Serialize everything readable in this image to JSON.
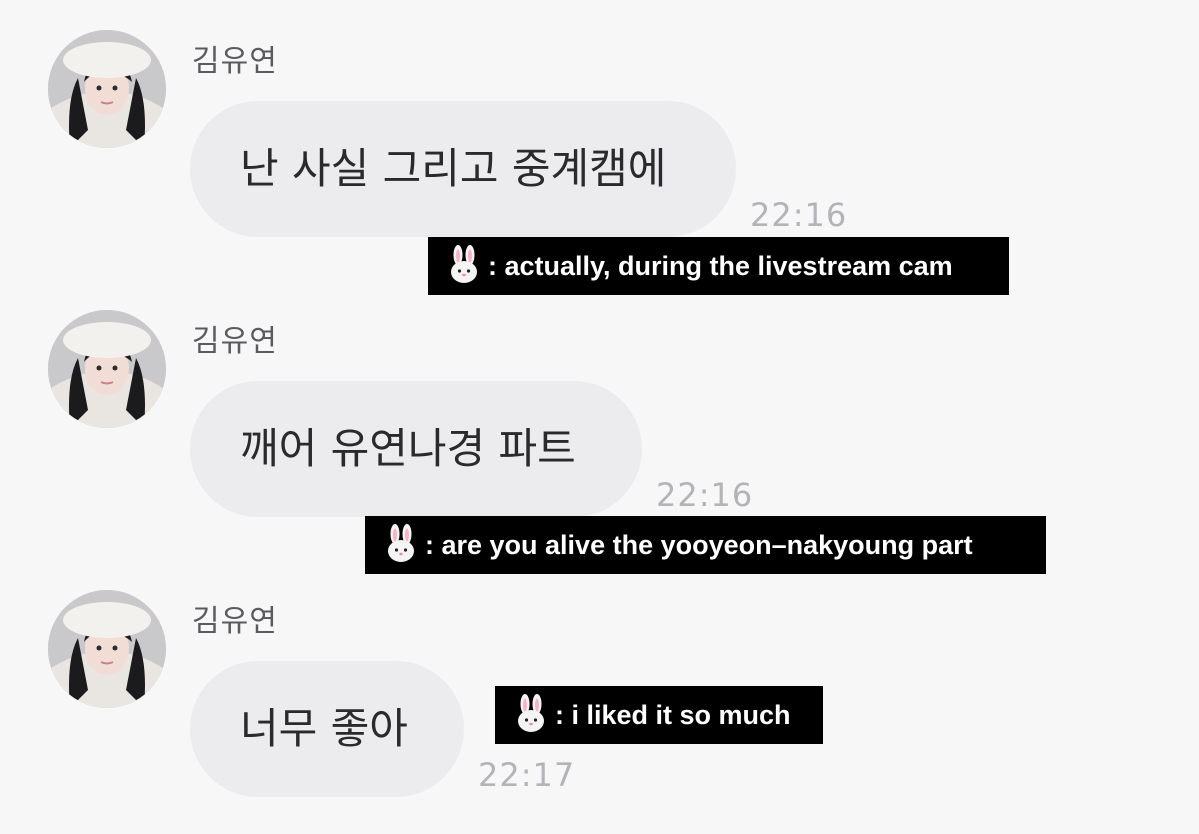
{
  "messages": [
    {
      "sender": "김유연",
      "text": "난 사실 그리고 중계캠에",
      "time": "22:16",
      "caption": ": actually, during the livestream cam"
    },
    {
      "sender": "김유연",
      "text": "깨어 유연나경 파트",
      "time": "22:16",
      "caption": ": are you alive the yooyeon–nakyoung part"
    },
    {
      "sender": "김유연",
      "text": "너무 좋아",
      "time": "22:17",
      "caption": ": i liked it so much"
    }
  ],
  "icons": {
    "caption_emoji": "rabbit-face-icon",
    "avatar": "profile-photo"
  },
  "colors": {
    "background": "#f7f7f8",
    "bubble": "#ececef",
    "caption_bg": "#000000",
    "caption_text": "#ffffff",
    "time": "#b4b4b8"
  }
}
